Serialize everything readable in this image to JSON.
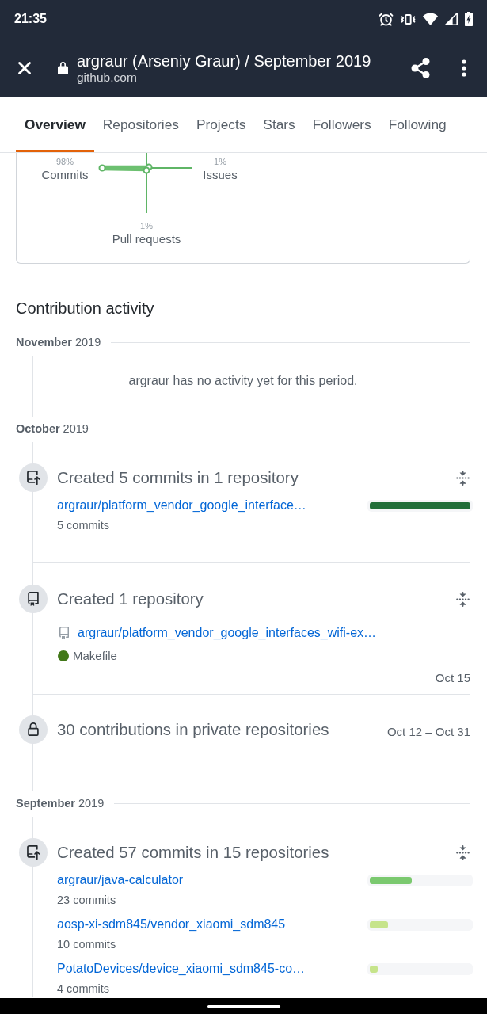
{
  "status_bar": {
    "time": "21:35"
  },
  "toolbar": {
    "title": "argraur (Arseniy Graur) / September 2019",
    "url": "github.com"
  },
  "tabs": [
    {
      "label": "Overview",
      "selected": true
    },
    {
      "label": "Repositories",
      "selected": false
    },
    {
      "label": "Projects",
      "selected": false
    },
    {
      "label": "Stars",
      "selected": false
    },
    {
      "label": "Followers",
      "selected": false
    },
    {
      "label": "Following",
      "selected": false
    }
  ],
  "activity_overview": {
    "axes": [
      {
        "kind": "left",
        "percent": "98%",
        "label": "Commits"
      },
      {
        "kind": "right",
        "percent": "1%",
        "label": "Issues"
      },
      {
        "kind": "bottom",
        "percent": "1%",
        "label": "Pull requests"
      }
    ]
  },
  "contribution_activity": {
    "title": "Contribution activity",
    "months": [
      {
        "label": "**November** 2019",
        "empty_message": "argraur has no activity yet for this period."
      },
      {
        "label": "**October** 2019",
        "events": [
          {
            "kind": "commits",
            "title": "Created 5 commits in 1 repository",
            "repositories": [
              {
                "name": "argraur/platform_vendor_google_interface…",
                "commits": "5 commits",
                "level": 1,
                "color": "#216e39"
              }
            ]
          },
          {
            "kind": "repository",
            "title": "Created 1 repository",
            "repositories": [
              {
                "name": "argraur/platform_vendor_google_interfaces_wifi-ex…",
                "language": "Makefile",
                "color": "#427819"
              }
            ],
            "date": "Oct 15"
          },
          {
            "kind": "private",
            "title": "30 contributions in private repositories",
            "date": "Oct 12 – Oct 31"
          }
        ]
      },
      {
        "label": "**September** 2019",
        "events": [
          {
            "kind": "commits",
            "title": "Created 57 commits in 15 repositories",
            "repositories": [
              {
                "name": "argraur/java-calculator",
                "commits": "23 commits",
                "level": 0.42,
                "color": "#7bc96f"
              },
              {
                "name": "aosp-xi-sdm845/vendor_xiaomi_sdm845",
                "commits": "10 commits",
                "level": 0.18,
                "color": "#c6e48b"
              },
              {
                "name": "PotatoDevices/device_xiaomi_sdm845-co…",
                "commits": "4 commits",
                "level": 0.08,
                "color": "#c6e48b"
              }
            ]
          }
        ]
      }
    ]
  }
}
